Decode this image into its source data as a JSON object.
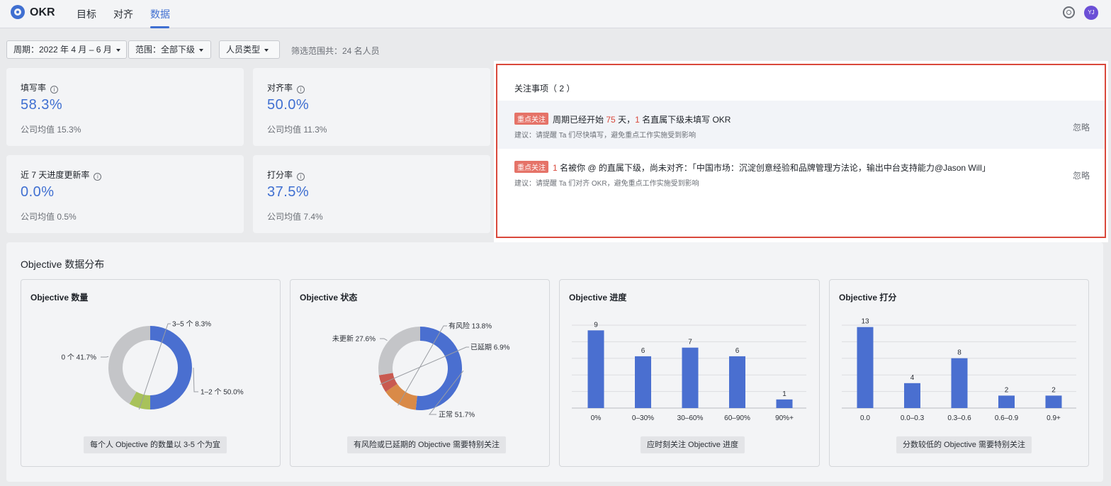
{
  "header": {
    "app_name": "OKR",
    "nav": [
      "目标",
      "对齐",
      "数据"
    ],
    "active_nav": "数据",
    "avatar_text": "YJ"
  },
  "filters": {
    "period": "周期：2022 年 4 月 – 6 月",
    "scope": "范围：全部下级",
    "person_type": "人员类型",
    "summary": "筛选范围共：24 名人员"
  },
  "stats": [
    {
      "label": "填写率",
      "value": "58.3%",
      "avg": "公司均值 15.3%"
    },
    {
      "label": "对齐率",
      "value": "50.0%",
      "avg": "公司均值 11.3%"
    },
    {
      "label": "近 7 天进度更新率",
      "value": "0.0%",
      "avg": "公司均值 0.5%"
    },
    {
      "label": "打分率",
      "value": "37.5%",
      "avg": "公司均值 7.4%"
    }
  ],
  "distribution": {
    "title": "Objective 数据分布",
    "panels": [
      {
        "title": "Objective 数量",
        "footer": "每个人 Objective 的数量以 3-5 个为宜"
      },
      {
        "title": "Objective 状态",
        "footer": "有风险或已延期的 Objective 需要特别关注"
      },
      {
        "title": "Objective 进度",
        "footer": "应时刻关注 Objective 进度"
      },
      {
        "title": "Objective 打分",
        "footer": "分数较低的 Objective 需要特别关注"
      }
    ]
  },
  "chart_data": [
    {
      "type": "pie",
      "title": "Objective 数量",
      "labels": [
        "1–2 个",
        "3–5 个",
        "0 个"
      ],
      "values": [
        50.0,
        8.3,
        41.7
      ],
      "label_text": [
        "1–2 个 50.0%",
        "3–5 个 8.3%",
        "0 个 41.7%"
      ],
      "colors": [
        "#4a6fd0",
        "#a8c25a",
        "#c4c5c8"
      ]
    },
    {
      "type": "pie",
      "title": "Objective 状态",
      "labels": [
        "正常",
        "有风险",
        "已延期",
        "未更新"
      ],
      "values": [
        51.7,
        13.8,
        6.9,
        27.6
      ],
      "label_text": [
        "正常 51.7%",
        "有风险 13.8%",
        "已延期 6.9%",
        "未更新 27.6%"
      ],
      "colors": [
        "#4a6fd0",
        "#d98a48",
        "#c95a50",
        "#c4c5c8"
      ]
    },
    {
      "type": "bar",
      "title": "Objective 进度",
      "categories": [
        "0%",
        "0–30%",
        "30–60%",
        "60–90%",
        "90%+"
      ],
      "values": [
        9,
        6,
        7,
        6,
        1
      ],
      "ylim": [
        0,
        10
      ]
    },
    {
      "type": "bar",
      "title": "Objective 打分",
      "categories": [
        "0.0",
        "0.0–0.3",
        "0.3–0.6",
        "0.6–0.9",
        "0.9+"
      ],
      "values": [
        13,
        4,
        8,
        2,
        2
      ],
      "ylim": [
        0,
        14
      ]
    }
  ],
  "focus": {
    "title": "关注事项（ 2 ）",
    "tag": "重点关注",
    "ignore_label": "忽略",
    "items": [
      {
        "num": "",
        "pre": "周期已经开始",
        "n1": "75",
        "mid": "天，",
        "n2": "1",
        "post": "名直属下级未填写 OKR",
        "suggestion": "建议：请提醒 Ta 们尽快填写，避免重点工作实施受到影响"
      },
      {
        "n1": "1",
        "post": "名被你 @ 的直属下级，尚未对齐：「中国市场：沉淀创意经验和品牌管理方法论，输出中台支持能力@Jason Will」",
        "suggestion": "建议：请提醒 Ta 们对齐 OKR，避免重点工作实施受到影响"
      }
    ]
  }
}
